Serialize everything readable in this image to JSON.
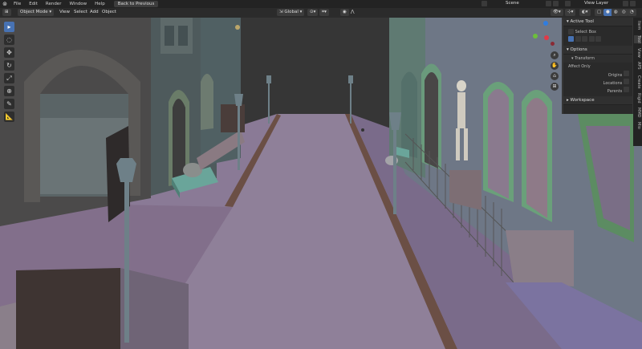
{
  "menu": {
    "file": "File",
    "edit": "Edit",
    "render": "Render",
    "window": "Window",
    "help": "Help",
    "back": "Back to Previous"
  },
  "top": {
    "scene": "Scene",
    "view_layer": "View Layer"
  },
  "header": {
    "mode": "Object Mode",
    "view": "View",
    "select": "Select",
    "add": "Add",
    "object": "Object",
    "orientation": "Global"
  },
  "tools": [
    {
      "icon": "▸"
    },
    {
      "icon": "◌"
    },
    {
      "icon": "✥"
    },
    {
      "icon": "↻"
    },
    {
      "icon": "⤢"
    },
    {
      "icon": "⊕"
    },
    {
      "icon": "✎"
    },
    {
      "icon": "📐"
    }
  ],
  "npanel": {
    "active_tool": "Active Tool",
    "select_box": "Select Box",
    "options": "Options",
    "transform": "Transform",
    "affect_only": "Affect Only",
    "origins": "Origins",
    "locations": "Locations",
    "parents": "Parents",
    "workspace": "Workspace"
  },
  "tabs": [
    "Item",
    "Tool",
    "View",
    "APS",
    "Create",
    "Rigid",
    "MMD",
    "Mio"
  ],
  "colors": {
    "accent": "#4772b3",
    "street": "#8a7a96",
    "sky": "#343434"
  }
}
